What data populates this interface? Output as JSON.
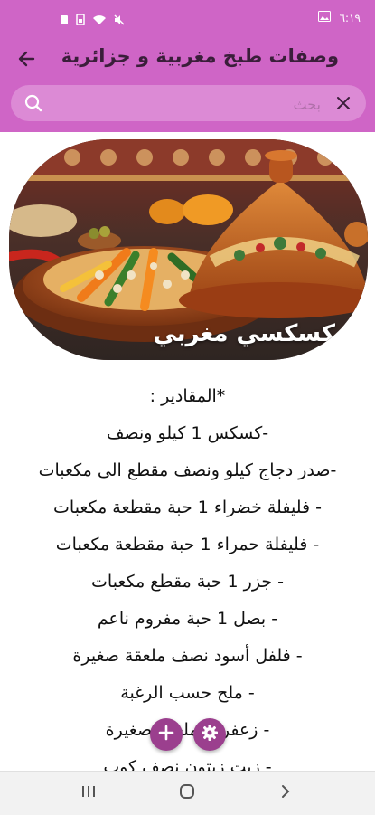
{
  "status_bar": {
    "time": "٦:١٩",
    "icons": [
      "notification-icon",
      "sim-icon",
      "wifi-icon",
      "mute-icon",
      "image-icon"
    ]
  },
  "app_bar": {
    "title": "وصفات طبخ مغربية و جزائرية",
    "back_icon": "arrow-back-icon"
  },
  "search": {
    "placeholder": "بحث",
    "value": "",
    "clear_icon": "close-icon",
    "search_icon": "search-icon"
  },
  "hero": {
    "caption": "كسكسي مغربي"
  },
  "recipe": {
    "lines": [
      "*المقادير :",
      "-كسكس 1 كيلو ونصف",
      "-صدر دجاج كيلو ونصف مقطع الى مكعبات",
      "- فليفلة خضراء 1 حبة مقطعة مكعبات",
      "- فليفلة حمراء 1 حبة مقطعة مكعبات",
      "- جزر 1 حبة مقطع مكعبات",
      "- بصل 1 حبة مفروم ناعم",
      "- فلفل أسود نصف ملعقة صغيرة",
      "- ملح حسب الرغبة",
      "- زعفران ملعقة صغيرة",
      "- زيت زيتون نصف كوب"
    ]
  },
  "fabs": {
    "add_icon": "plus-icon",
    "settings_icon": "gear-icon"
  },
  "nav_bar": {
    "icons": [
      "recent-apps-icon",
      "home-icon",
      "back-chevron-icon"
    ]
  },
  "colors": {
    "primary": "#cf65c6",
    "search_bg": "#dc8ad5",
    "fab": "#9b3f8e"
  }
}
